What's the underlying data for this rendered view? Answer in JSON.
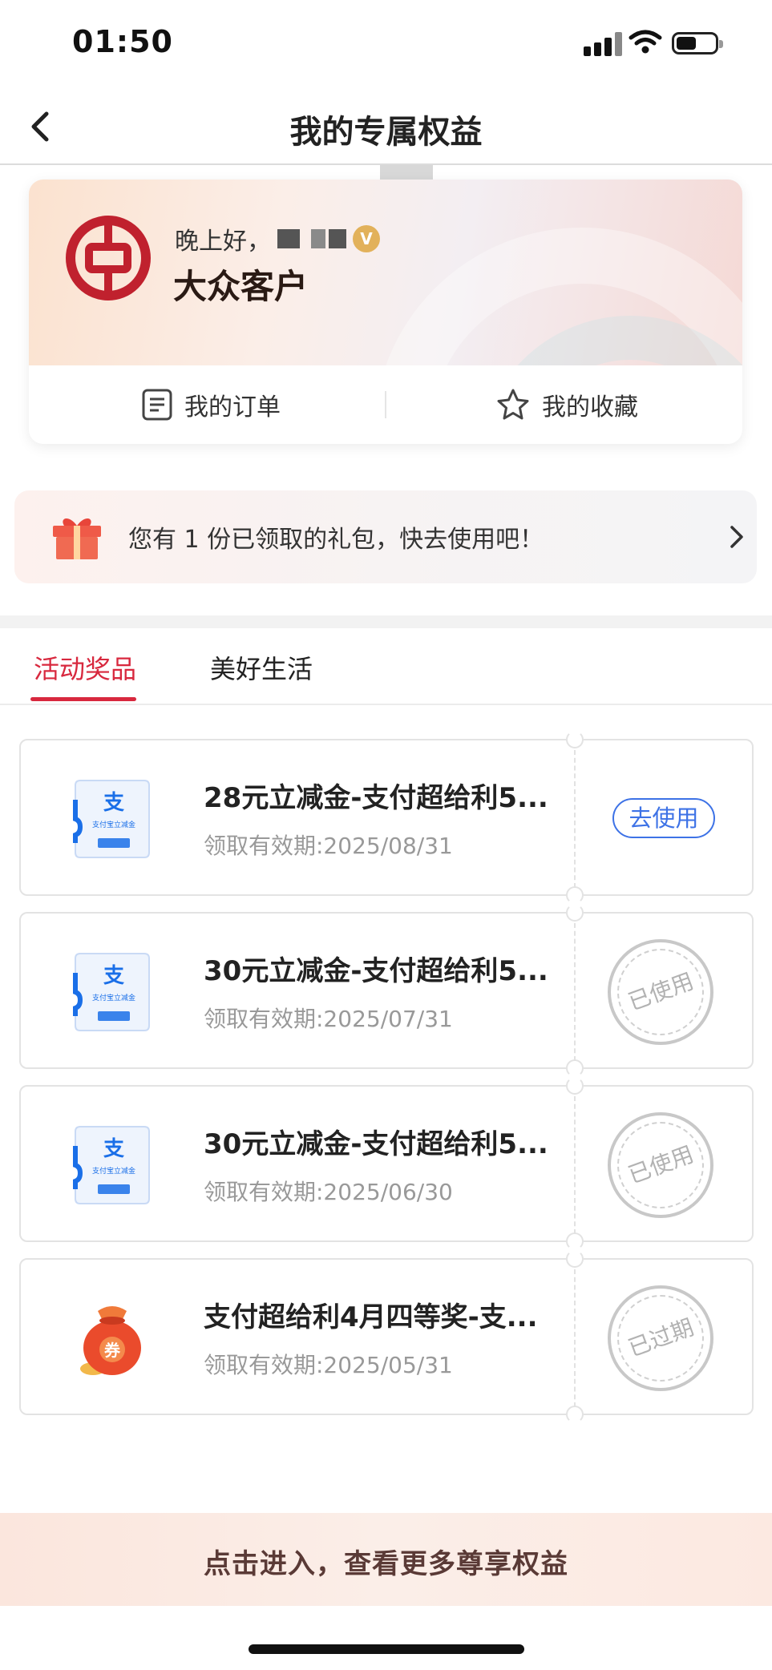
{
  "status_bar": {
    "time": "01:50"
  },
  "nav": {
    "title": "我的专属权益"
  },
  "profile": {
    "greeting": "晚上好，",
    "badge": "V",
    "tier": "大众客户",
    "actions": {
      "orders": "我的订单",
      "favorites": "我的收藏"
    }
  },
  "gift_banner": {
    "text": "您有 1 份已领取的礼包，快去使用吧！"
  },
  "tabs": [
    {
      "label": "活动奖品",
      "active": true
    },
    {
      "label": "美好生活",
      "active": false
    }
  ],
  "coupons": [
    {
      "title": "28元立减金-支付超给利5...",
      "validity": "领取有效期:2025/08/31",
      "status": "去使用",
      "icon": "alipay-coupon-icon"
    },
    {
      "title": "30元立减金-支付超给利5...",
      "validity": "领取有效期:2025/07/31",
      "status": "已使用",
      "icon": "alipay-coupon-icon"
    },
    {
      "title": "30元立减金-支付超给利5...",
      "validity": "领取有效期:2025/06/30",
      "status": "已使用",
      "icon": "alipay-coupon-icon"
    },
    {
      "title": "支付超给利4月四等奖-支...",
      "validity": "领取有效期:2025/05/31",
      "status": "已过期",
      "icon": "red-envelope-coupon-icon"
    }
  ],
  "coupon_thumb": {
    "alipay_char": "支",
    "alipay_caption": "支付宝立减金",
    "bag_char": "券"
  },
  "bottom_banner": {
    "text": "点击进入，查看更多尊享权益"
  },
  "colors": {
    "accent_red": "#d8283e",
    "link_blue": "#3d72e6",
    "stamp_gray": "#c8c8c8"
  }
}
